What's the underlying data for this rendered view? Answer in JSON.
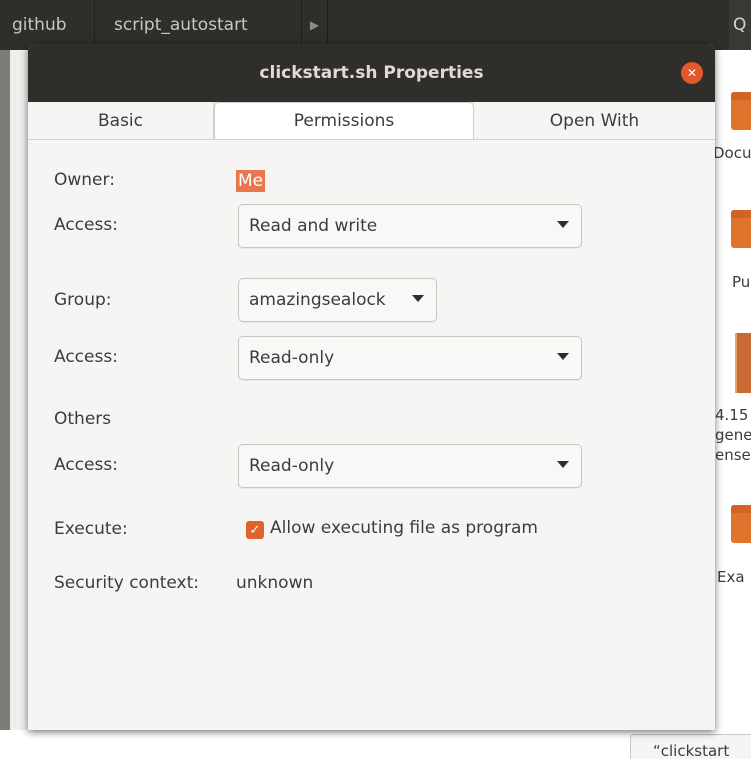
{
  "background": {
    "breadcrumbs": [
      "github",
      "script_autostart"
    ],
    "right_labels": [
      "Docu",
      "Pu",
      "4.15",
      "gene",
      "ense",
      "Exa"
    ],
    "status_text": "“clickstart"
  },
  "dialog": {
    "title": "clickstart.sh Properties",
    "tabs": [
      "Basic",
      "Permissions",
      "Open With"
    ],
    "owner_label": "Owner:",
    "owner_value": "Me",
    "owner_access_label": "Access:",
    "owner_access_value": "Read and write",
    "group_label": "Group:",
    "group_value": "amazingsealock",
    "group_access_label": "Access:",
    "group_access_value": "Read-only",
    "others_label": "Others",
    "others_access_label": "Access:",
    "others_access_value": "Read-only",
    "execute_label": "Execute:",
    "execute_checkbox_label": "Allow executing file as program",
    "execute_checked": true,
    "security_label": "Security context:",
    "security_value": "unknown"
  },
  "colors": {
    "accent": "#e9764d",
    "titlebar": "#2f2e2b",
    "close": "#e2572b"
  }
}
